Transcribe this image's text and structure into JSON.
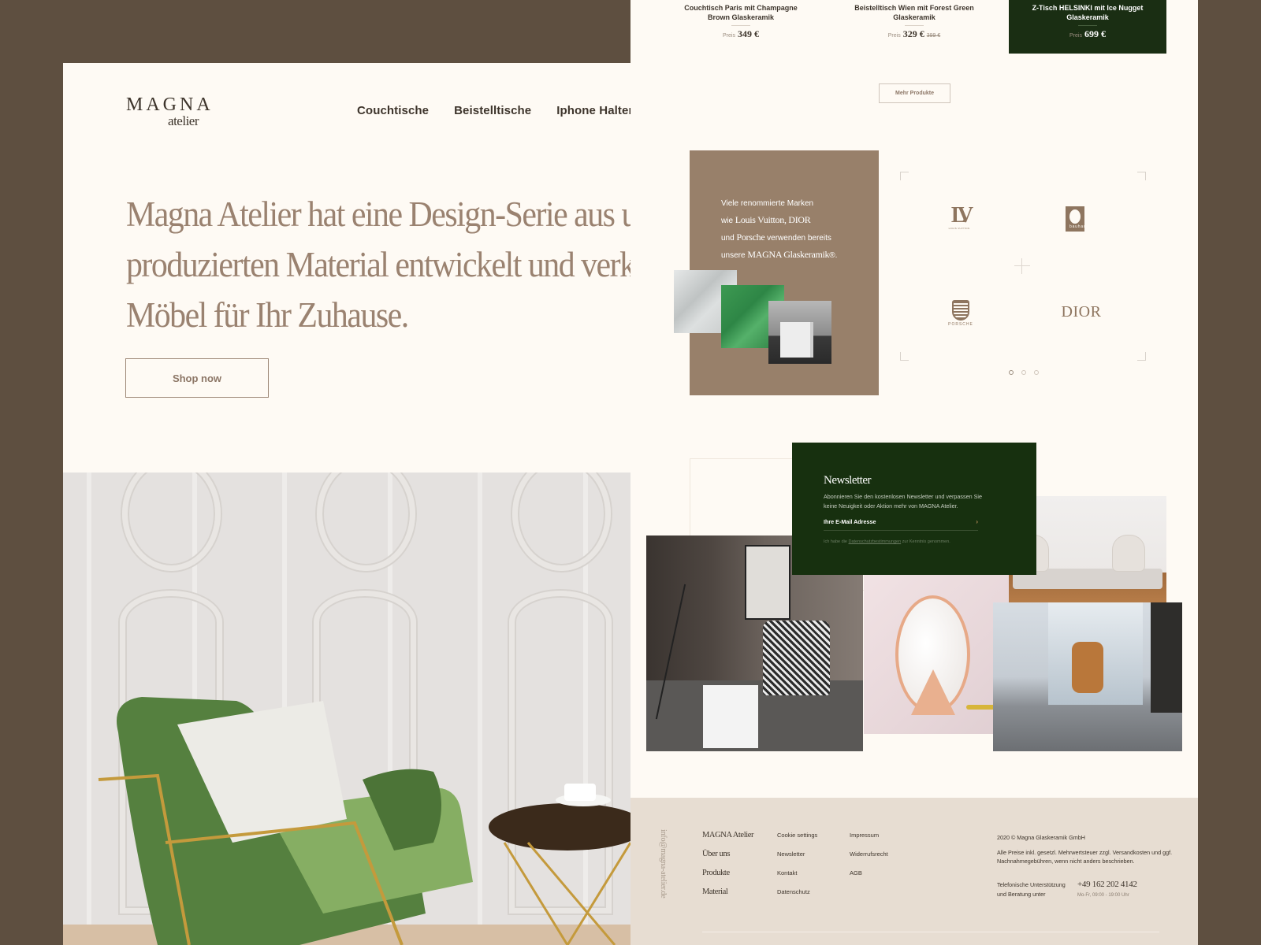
{
  "colors": {
    "backdrop": "#5e4f40",
    "page": "#fefaf4",
    "accent_brown": "#98806a",
    "text_dark": "#3d342b",
    "hero_text": "#9a8270",
    "forest_green": "#17300f",
    "footer_bg": "#e7ddd2"
  },
  "header": {
    "logo_primary": "MAGNA",
    "logo_secondary": "atelier",
    "nav": [
      {
        "label": "Couchtische"
      },
      {
        "label": "Beistelltische"
      },
      {
        "label": "Iphone Halterun"
      }
    ]
  },
  "hero": {
    "lines": [
      "Magna Atelier hat eine Design-Serie aus un",
      "produzierten Material entwickelt und verka",
      "Möbel für Ihr Zuhause."
    ],
    "cta_label": "Shop now"
  },
  "products": {
    "price_label": "Preis",
    "items": [
      {
        "name_line1": "Couchtisch Paris mit Champagne",
        "name_line2": "Brown Glaskeramik",
        "price": "349 €",
        "old_price": null,
        "highlighted": false
      },
      {
        "name_line1": "Beistelltisch Wien mit Forest Green",
        "name_line2": "Glaskeramik",
        "price": "329 €",
        "old_price": "399 €",
        "highlighted": false
      },
      {
        "name_line1": "Z-Tisch HELSINKI mit Ice Nugget",
        "name_line2": "Glaskeramik",
        "price": "699 €",
        "old_price": null,
        "highlighted": true
      }
    ],
    "more_label": "Mehr Produkte"
  },
  "brands": {
    "copy": {
      "line1": "Viele renommierte Marken",
      "line2_prefix": "wie ",
      "line2_serif": "Louis Vuitton, DIOR",
      "line3_prefix": "und ",
      "line3_serif": "Porsche",
      "line3_suffix": " verwenden bereits",
      "line4_prefix": "unsere ",
      "line4_serif": "MAGNA Glaskeramik",
      "line4_suffix": "®."
    },
    "logos": {
      "lv_mono": "LV",
      "lv_sub": "LOUIS VUITTON",
      "bauhaus": "bauhaus",
      "porsche": "PORSCHE",
      "dior": "DIOR"
    },
    "carousel_pages": 3,
    "carousel_active": 1
  },
  "newsletter": {
    "title": "Newsletter",
    "description": "Abonnieren Sie den kostenlosen Newsletter und verpassen Sie keine Neuigkeit oder Aktion mehr von MAGNA Atelier.",
    "email_placeholder": "Ihre E-Mail Adresse",
    "submit_icon": "›",
    "consent_prefix": "Ich habe die ",
    "consent_link": "Datenschutzbestimmungen",
    "consent_suffix": " zur Kenntnis genommen."
  },
  "footer": {
    "email": "info@magna-atelier.de",
    "primary_links": [
      "MAGNA Atelier",
      "Über uns",
      "Produkte",
      "Material"
    ],
    "secondary_links": [
      "Cookie settings",
      "Newsletter",
      "Kontakt",
      "Datenschutz"
    ],
    "legal_links": [
      "Impressum",
      "Widerrufsrecht",
      "AGB"
    ],
    "copyright": "2020 © Magna Glaskeramik GmbH",
    "vat_note": "Alle Preise inkl. gesetzl. Mehrwertsteuer zzgl. Versandkosten und ggf. Nachnahmegebühren, wenn nicht anders beschrieben.",
    "support_label": "Telefonische Unterstützung und Beratung unter",
    "phone": "+49 162 202 4142",
    "hours": "Mo-Fr, 09:00 - 19:00 Uhr"
  }
}
